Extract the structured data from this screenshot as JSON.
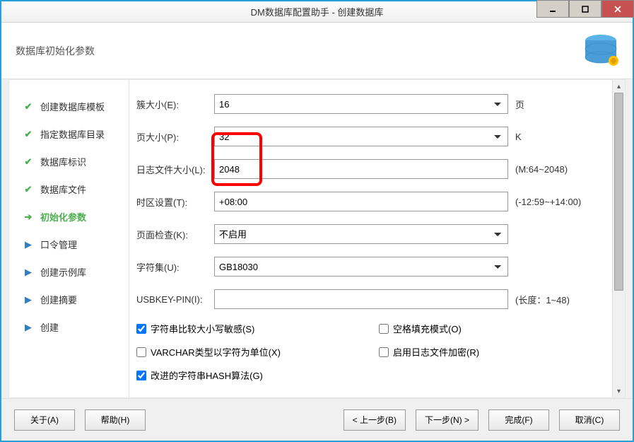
{
  "window": {
    "title": "DM数据库配置助手 - 创建数据库"
  },
  "header": {
    "title": "数据库初始化参数"
  },
  "sidebar": {
    "steps": [
      {
        "label": "创建数据库模板",
        "state": "done"
      },
      {
        "label": "指定数据库目录",
        "state": "done"
      },
      {
        "label": "数据库标识",
        "state": "done"
      },
      {
        "label": "数据库文件",
        "state": "done"
      },
      {
        "label": "初始化参数",
        "state": "current"
      },
      {
        "label": "口令管理",
        "state": "pending"
      },
      {
        "label": "创建示例库",
        "state": "pending"
      },
      {
        "label": "创建摘要",
        "state": "pending"
      },
      {
        "label": "创建",
        "state": "pending"
      }
    ]
  },
  "form": {
    "cluster_size": {
      "label": "簇大小(E):",
      "value": "16",
      "suffix": "页"
    },
    "page_size": {
      "label": "页大小(P):",
      "value": "32",
      "suffix": "K"
    },
    "log_size": {
      "label": "日志文件大小(L):",
      "value": "2048",
      "suffix": "(M:64~2048)"
    },
    "timezone": {
      "label": "时区设置(T):",
      "value": "+08:00",
      "suffix": "(-12:59~+14:00)"
    },
    "page_check": {
      "label": "页面检查(K):",
      "value": "不启用",
      "suffix": ""
    },
    "charset": {
      "label": "字符集(U):",
      "value": "GB18030",
      "suffix": ""
    },
    "usbkey": {
      "label": "USBKEY-PIN(I):",
      "value": "",
      "suffix": "(长度：1~48)"
    },
    "checkboxes": {
      "case_sensitive": {
        "label": "字符串比较大小写敏感(S)",
        "checked": true
      },
      "blank_pad": {
        "label": "空格填充模式(O)",
        "checked": false
      },
      "varchar_char": {
        "label": "VARCHAR类型以字符为单位(X)",
        "checked": false
      },
      "log_encrypt": {
        "label": "启用日志文件加密(R)",
        "checked": false
      },
      "hash_improved": {
        "label": "改进的字符串HASH算法(G)",
        "checked": true
      }
    }
  },
  "footer": {
    "about": "关于(A)",
    "help": "帮助(H)",
    "prev": "< 上一步(B)",
    "next": "下一步(N) >",
    "finish": "完成(F)",
    "cancel": "取消(C)"
  }
}
